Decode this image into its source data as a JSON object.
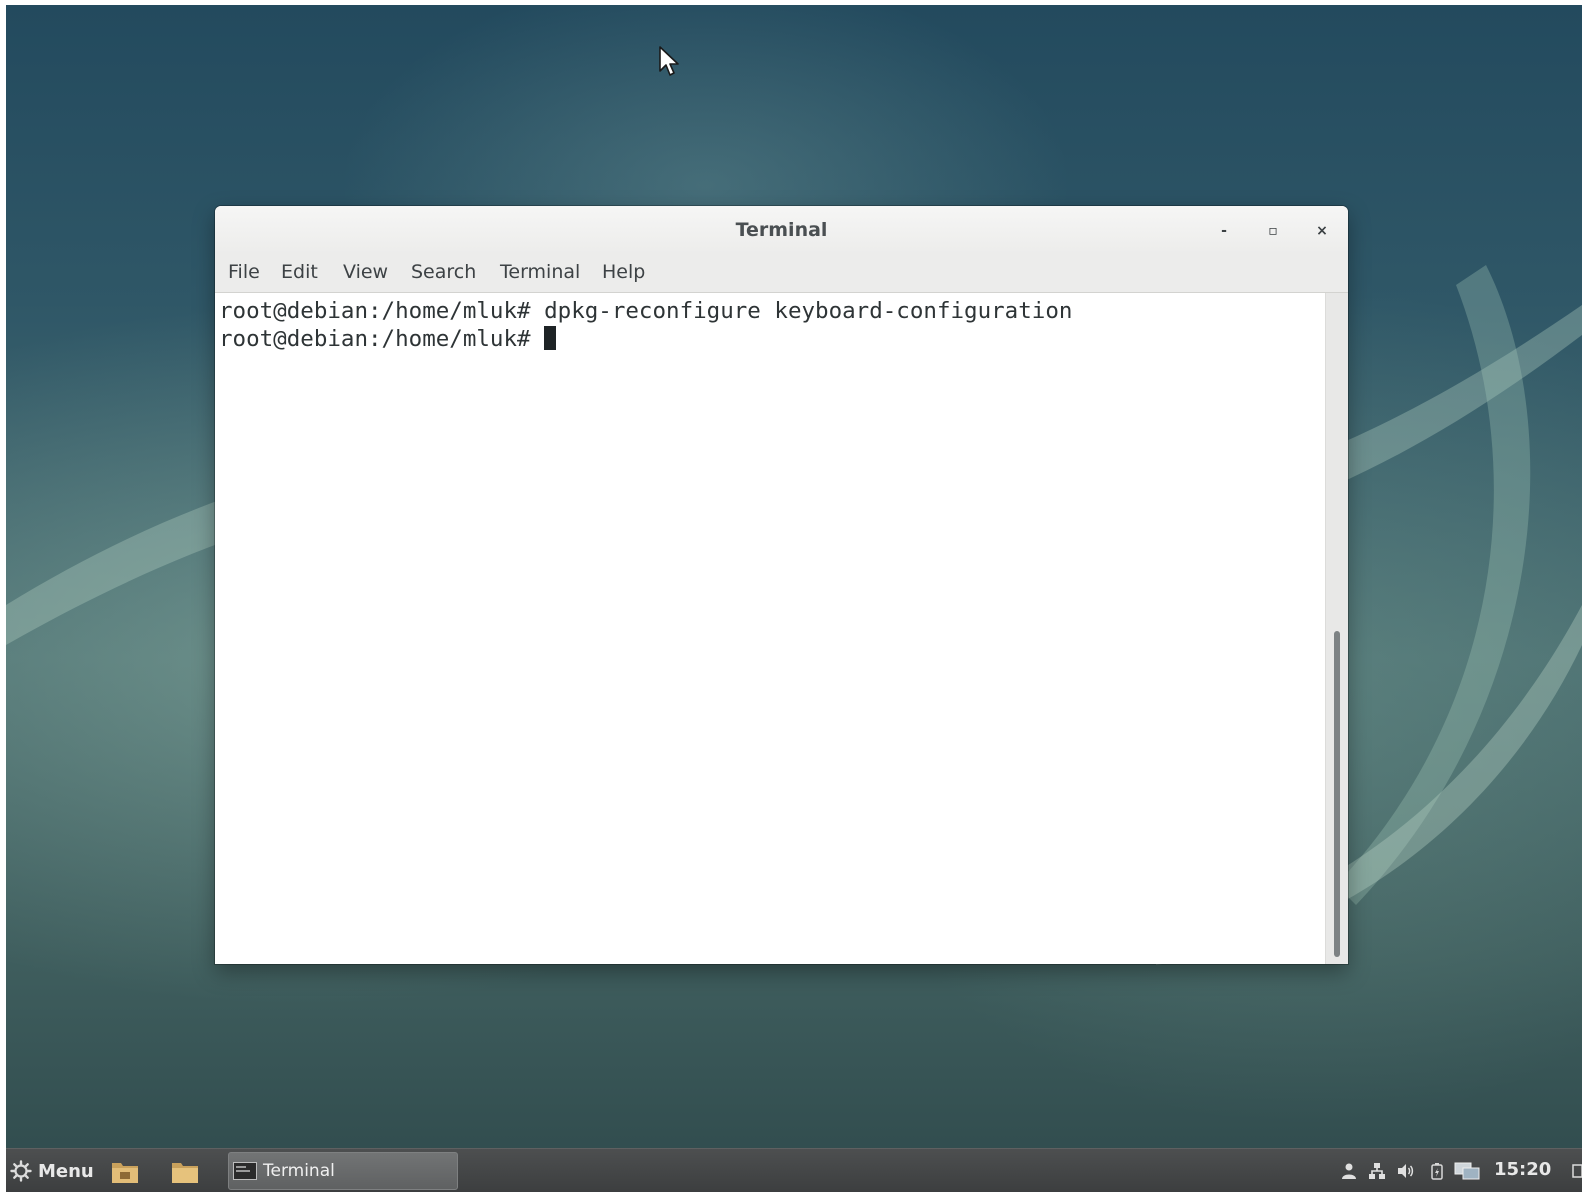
{
  "window": {
    "title": "Terminal",
    "minimize_label": "-",
    "maximize_label": "▫",
    "close_label": "×"
  },
  "menubar": {
    "items": [
      "File",
      "Edit",
      "View",
      "Search",
      "Terminal",
      "Help"
    ]
  },
  "terminal": {
    "lines": [
      "root@debian:/home/mluk# dpkg-reconfigure keyboard-configuration",
      "root@debian:/home/mluk# "
    ]
  },
  "taskbar": {
    "menu_label": "Menu",
    "menu_icon": "gear-icon",
    "launchers": [
      "file-manager-home-icon",
      "folder-icon"
    ],
    "tasks": [
      {
        "label": "Terminal",
        "icon": "terminal-icon"
      }
    ],
    "tray_icons": [
      "user-icon",
      "network-icon",
      "volume-icon",
      "battery-icon",
      "display-icon"
    ],
    "clock": "15:20"
  },
  "colors": {
    "desktop_dark": "#234a5e",
    "desktop_teal": "#4b6f71",
    "window_titlebar": "#ececeb",
    "terminal_background": "#ffffff",
    "terminal_text": "#2e3436",
    "taskbar": "#444647"
  }
}
